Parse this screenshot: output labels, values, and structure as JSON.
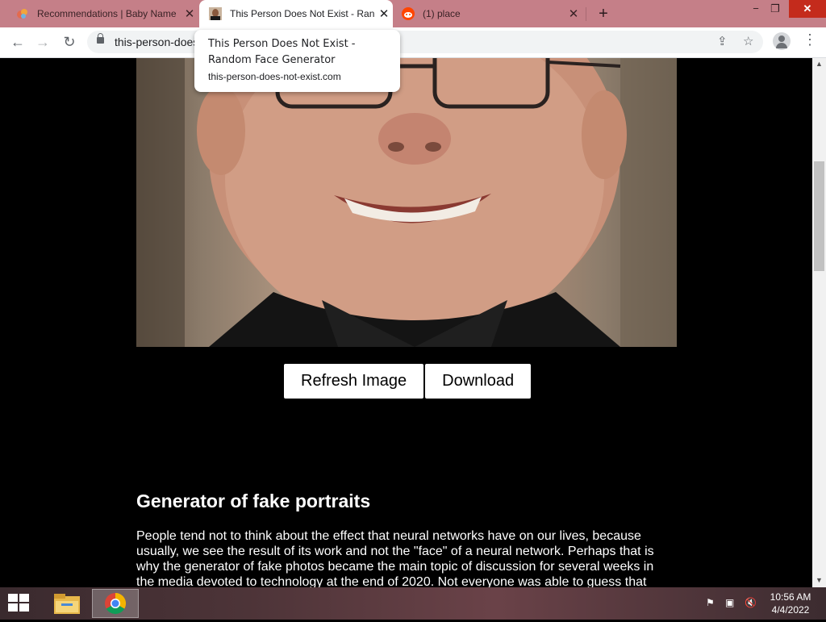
{
  "browser": {
    "tabs": [
      {
        "title": "Recommendations | Baby Name",
        "favicon": "baby-name-icon",
        "active": false
      },
      {
        "title": "This Person Does Not Exist - Ran",
        "favicon": "portrait-favicon",
        "active": true
      },
      {
        "title": "(1) place",
        "favicon": "reddit-icon",
        "active": false
      }
    ],
    "url": "this-person-does",
    "tooltip": {
      "title": "This Person Does Not Exist - Random Face Generator",
      "url": "this-person-does-not-exist.com"
    }
  },
  "page": {
    "buttons": {
      "refresh": "Refresh Image",
      "download": "Download"
    },
    "heading": "Generator of fake portraits",
    "paragraph": "People tend not to think about the effect that neural networks have on our lives, because usually, we see the result of its work and not the \"face\" of a neural network. Perhaps that is why the generator of fake photos became the main topic of discussion for several weeks in the media devoted to technology at the end of 2020. Not everyone was able to guess that AI"
  },
  "taskbar": {
    "apps": [
      "file-explorer-icon",
      "chrome-icon"
    ],
    "time": "10:56 AM",
    "date": "4/4/2022"
  },
  "colors": {
    "tabstrip": "#c57f88",
    "page_background": "#000000",
    "button_background": "#ffffff"
  }
}
